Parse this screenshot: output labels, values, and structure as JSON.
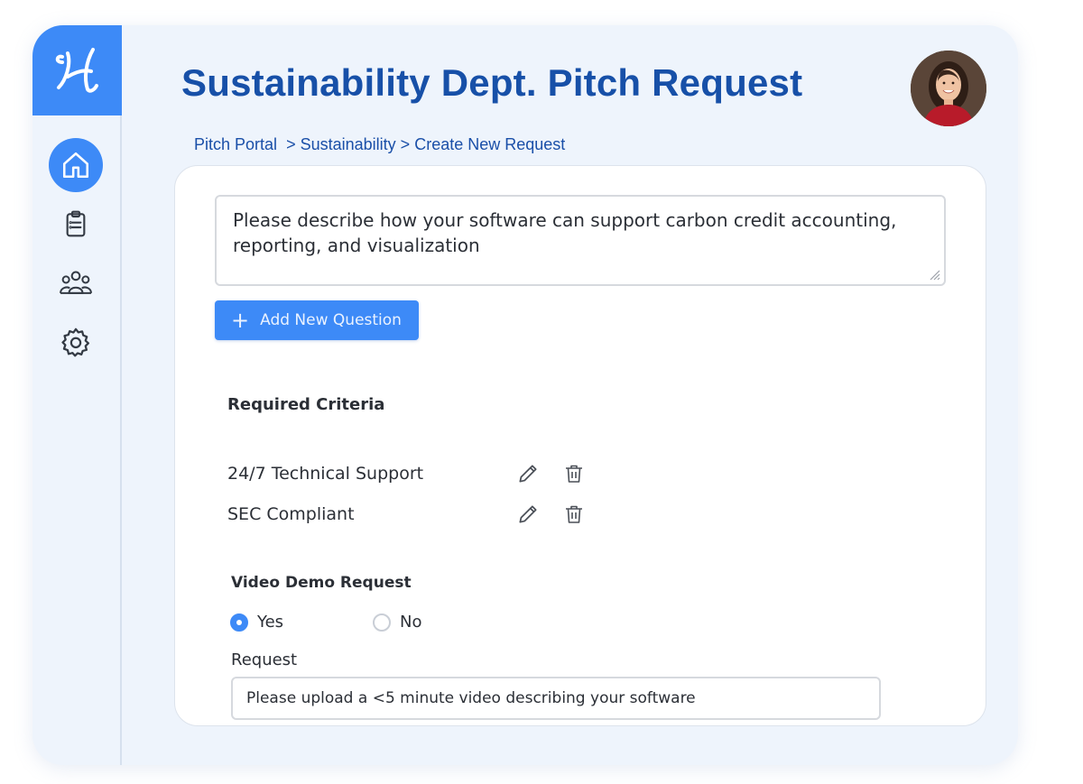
{
  "header": {
    "title": "Sustainability Dept. Pitch Request",
    "logo_letter": "H"
  },
  "breadcrumb": {
    "items": [
      "Pitch Portal",
      "Sustainability",
      "Create New Request"
    ],
    "separator": ">"
  },
  "sidebar": {
    "items": [
      {
        "icon": "home-icon",
        "active": true
      },
      {
        "icon": "clipboard-icon",
        "active": false
      },
      {
        "icon": "users-icon",
        "active": false
      },
      {
        "icon": "gear-icon",
        "active": false
      }
    ]
  },
  "question": {
    "value": "Please describe how your software can support carbon credit accounting, reporting, and visualization"
  },
  "add_question_button": {
    "label": "Add New Question"
  },
  "required_criteria": {
    "heading": "Required Criteria",
    "items": [
      {
        "label": "24/7 Technical Support"
      },
      {
        "label": "SEC Compliant"
      }
    ]
  },
  "video_demo": {
    "heading": "Video Demo Request",
    "options": [
      {
        "label": "Yes",
        "checked": true
      },
      {
        "label": "No",
        "checked": false
      }
    ],
    "request_label": "Request",
    "request_value": "Please upload a <5 minute video describing your software"
  },
  "colors": {
    "accent": "#3d8af7",
    "title": "#1750a8",
    "background": "#eef4fc"
  }
}
